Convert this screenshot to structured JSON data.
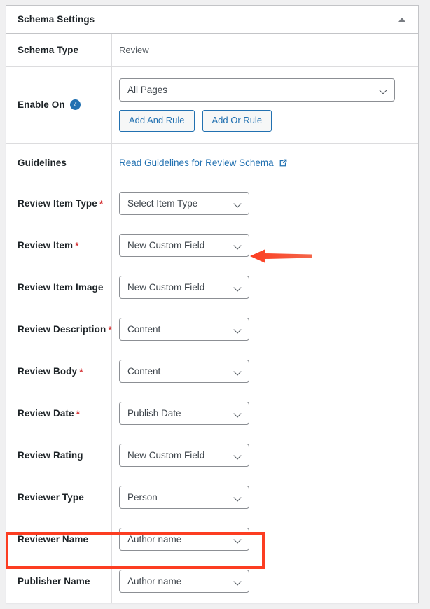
{
  "panel": {
    "title": "Schema Settings",
    "collapse_icon": "caret-up-icon"
  },
  "rows": {
    "schema_type": {
      "label": "Schema Type",
      "value": "Review"
    },
    "enable_on": {
      "label": "Enable On",
      "help_icon": "help-question-icon",
      "select_value": "All Pages",
      "buttons": [
        "Add And Rule",
        "Add Or Rule"
      ]
    },
    "guidelines": {
      "label": "Guidelines",
      "link_text": "Read Guidelines for Review Schema",
      "link_icon": "external-link-icon"
    }
  },
  "fields": [
    {
      "label": "Review Item Type",
      "required": true,
      "value": "Select Item Type"
    },
    {
      "label": "Review Item",
      "required": true,
      "value": "New Custom Field"
    },
    {
      "label": "Review Item Image",
      "required": false,
      "value": "New Custom Field"
    },
    {
      "label": "Review Description",
      "required": true,
      "value": "Content"
    },
    {
      "label": "Review Body",
      "required": true,
      "value": "Content"
    },
    {
      "label": "Review Date",
      "required": true,
      "value": "Publish Date"
    },
    {
      "label": "Review Rating",
      "required": false,
      "value": "New Custom Field"
    },
    {
      "label": "Reviewer Type",
      "required": false,
      "value": "Person"
    },
    {
      "label": "Reviewer Name",
      "required": false,
      "value": "Author name"
    },
    {
      "label": "Publisher Name",
      "required": false,
      "value": "Author name"
    }
  ],
  "annotations": {
    "arrow_color": "#fc3d21",
    "highlight_color": "#fc3d21",
    "arrow_points_to": "Review Item",
    "highlight_surrounds": "Reviewer Name"
  },
  "colors": {
    "link": "#2271b1",
    "required_star": "#d63638",
    "page_background": "#f0f0f1",
    "card_border": "#c3c4c7"
  }
}
